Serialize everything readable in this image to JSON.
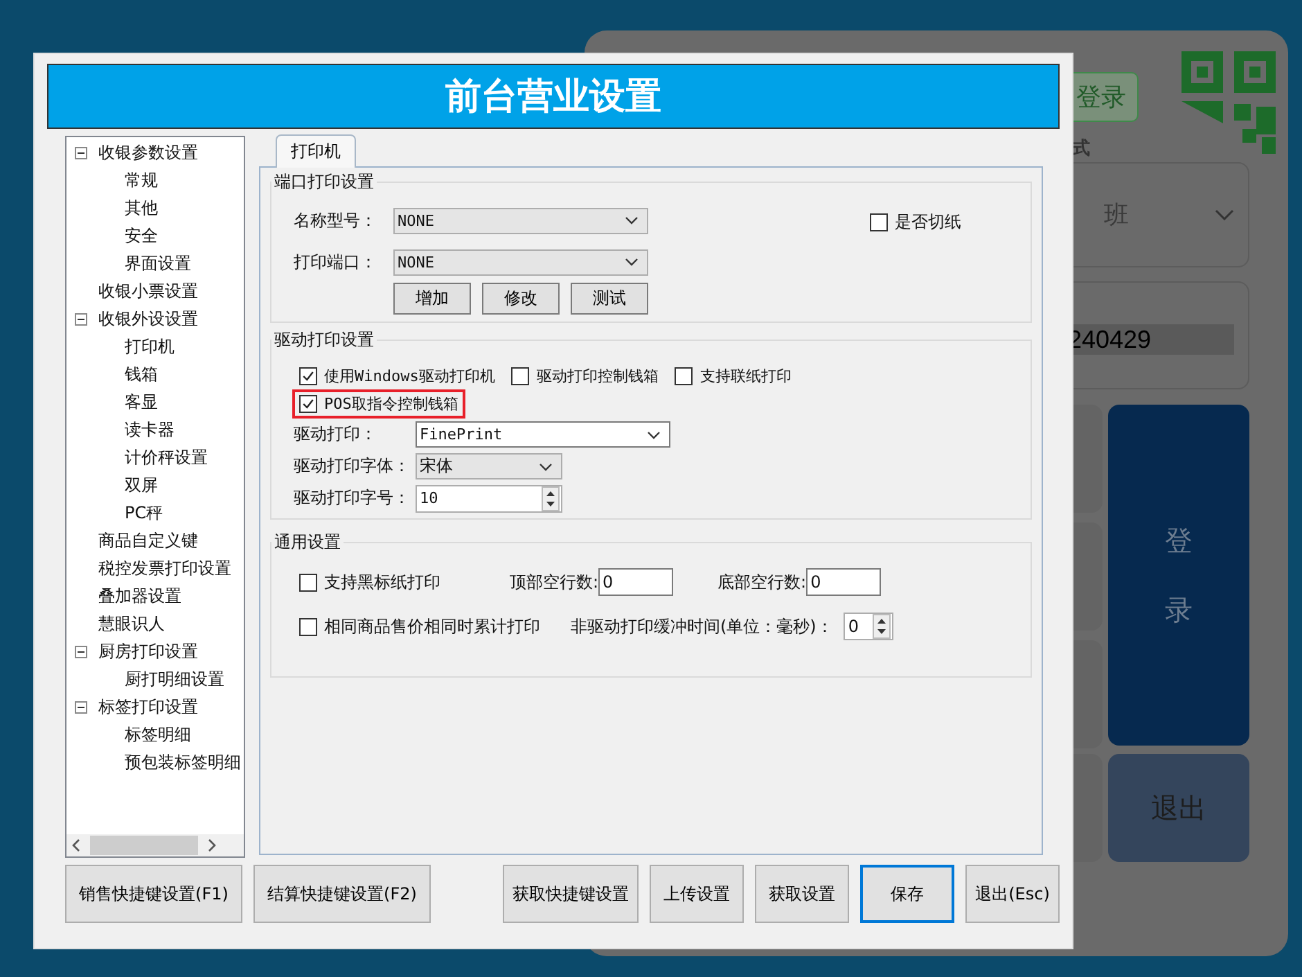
{
  "background_panel": {
    "tag": "登录",
    "caption": "式",
    "shift_select": {
      "value": "班"
    },
    "code_field": {
      "value": "240429"
    },
    "login_button": "登录",
    "exit_button": "退出"
  },
  "dialog": {
    "title": "前台营业设置"
  },
  "tree": [
    {
      "label": "收银参数设置",
      "expanded": true,
      "children": [
        {
          "label": "常规"
        },
        {
          "label": "其他"
        },
        {
          "label": "安全"
        },
        {
          "label": "界面设置"
        }
      ]
    },
    {
      "label": "收银小票设置"
    },
    {
      "label": "收银外设设置",
      "expanded": true,
      "children": [
        {
          "label": "打印机"
        },
        {
          "label": "钱箱"
        },
        {
          "label": "客显"
        },
        {
          "label": "读卡器"
        },
        {
          "label": "计价秤设置"
        },
        {
          "label": "双屏"
        },
        {
          "label": "PC秤"
        }
      ]
    },
    {
      "label": "商品自定义键"
    },
    {
      "label": "税控发票打印设置"
    },
    {
      "label": "叠加器设置"
    },
    {
      "label": "慧眼识人"
    },
    {
      "label": "厨房打印设置",
      "expanded": true,
      "children": [
        {
          "label": "厨打明细设置"
        }
      ]
    },
    {
      "label": "标签打印设置",
      "expanded": true,
      "children": [
        {
          "label": "标签明细"
        },
        {
          "label": "预包装标签明细"
        }
      ]
    }
  ],
  "tabs": [
    {
      "label": "打印机",
      "selected": true
    }
  ],
  "port_group": {
    "title": "端口打印设置",
    "fields": [
      {
        "label": "名称型号：",
        "value": "NONE"
      },
      {
        "label": "打印端口：",
        "value": "NONE"
      }
    ],
    "buttons": [
      "增加",
      "修改",
      "测试"
    ],
    "cut_paper": {
      "label": "是否切纸",
      "checked": false
    }
  },
  "driver_group": {
    "title": "驱动打印设置",
    "checkboxes": [
      {
        "label": "使用Windows驱动打印机",
        "checked": true,
        "highlighted": false
      },
      {
        "label": "驱动打印控制钱箱",
        "checked": false,
        "highlighted": false
      },
      {
        "label": "支持联纸打印",
        "checked": false,
        "highlighted": false
      },
      {
        "label": "POS取指令控制钱箱",
        "checked": true,
        "highlighted": true
      }
    ],
    "printer": {
      "label": "驱动打印：",
      "value": "FinePrint"
    },
    "font": {
      "label": "驱动打印字体：",
      "value": "宋体"
    },
    "font_size": {
      "label": "驱动打印字号：",
      "value": "10"
    }
  },
  "general_group": {
    "title": "通用设置",
    "black_mark": {
      "label": "支持黑标纸打印",
      "checked": false
    },
    "top_blank": {
      "label": "顶部空行数:",
      "value": "0"
    },
    "bottom_blank": {
      "label": "底部空行数:",
      "value": "0"
    },
    "accumulate": {
      "label": "相同商品售价相同时累计打印",
      "checked": false
    },
    "buffer": {
      "label": "非驱动打印缓冲时间(单位：毫秒)：",
      "value": "0"
    }
  },
  "left_buttons": [
    {
      "label": "销售快捷键设置(F1)",
      "default": false
    },
    {
      "label": "结算快捷键设置(F2)",
      "default": false
    }
  ],
  "right_buttons": [
    {
      "label": "获取快捷键设置",
      "default": false
    },
    {
      "label": "上传设置",
      "default": false
    },
    {
      "label": "获取设置",
      "default": false
    },
    {
      "label": "保存",
      "default": true
    },
    {
      "label": "退出(Esc)",
      "default": false
    }
  ]
}
